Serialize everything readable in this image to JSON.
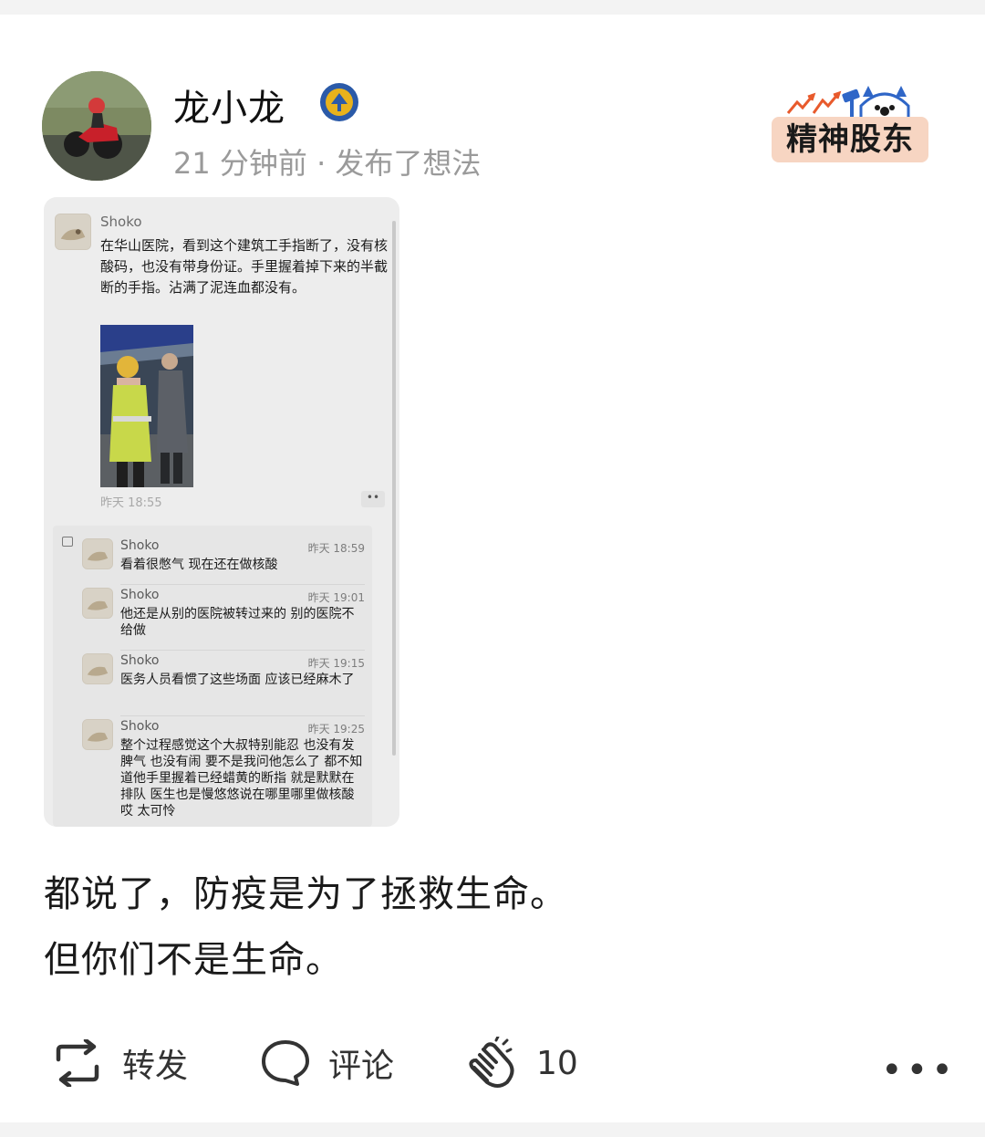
{
  "post": {
    "author": "龙小龙",
    "meta": "21 分钟前 · 发布了想法",
    "brand_logo": "精神股东",
    "text_lines": [
      "都说了，防疫是为了拯救生命。",
      "但你们不是生命。"
    ]
  },
  "screenshot": {
    "main_message": {
      "name": "Shoko",
      "text": "在华山医院，看到这个建筑工手指断了，没有核酸码，也没有带身份证。手里握着掉下来的半截断的手指。沾满了泥连血都没有。",
      "time": "昨天 18:55"
    },
    "replies": [
      {
        "name": "Shoko",
        "time": "昨天 18:59",
        "text": "看着很憋气 现在还在做核酸"
      },
      {
        "name": "Shoko",
        "time": "昨天 19:01",
        "text": "他还是从别的医院被转过来的 别的医院不给做"
      },
      {
        "name": "Shoko",
        "time": "昨天 19:15",
        "text": "医务人员看惯了这些场面 应该已经麻木了"
      },
      {
        "name": "Shoko",
        "time": "昨天 19:25",
        "text": "整个过程感觉这个大叔特别能忍 也没有发脾气 也没有闹 要不是我问他怎么了 都不知道他手里握着已经蜡黄的断指 就是默默在排队 医生也是慢悠悠说在哪里哪里做核酸 哎 太可怜"
      }
    ]
  },
  "actions": {
    "repost_label": "转发",
    "comment_label": "评论",
    "clap_count": "10",
    "more_label": "•••"
  },
  "colors": {
    "meta_gray": "#9a9a9a",
    "logo_bg": "#f7d5c2",
    "logo_accent": "#e85a2c",
    "logo_blue": "#2f66c7",
    "badge_blue": "#2b5aa8",
    "badge_gold": "#e8b21c"
  },
  "icons": {
    "repost": "repost-icon",
    "comment": "comment-icon",
    "clap": "clap-icon",
    "more": "more-icon",
    "verified": "verified-badge-icon"
  }
}
